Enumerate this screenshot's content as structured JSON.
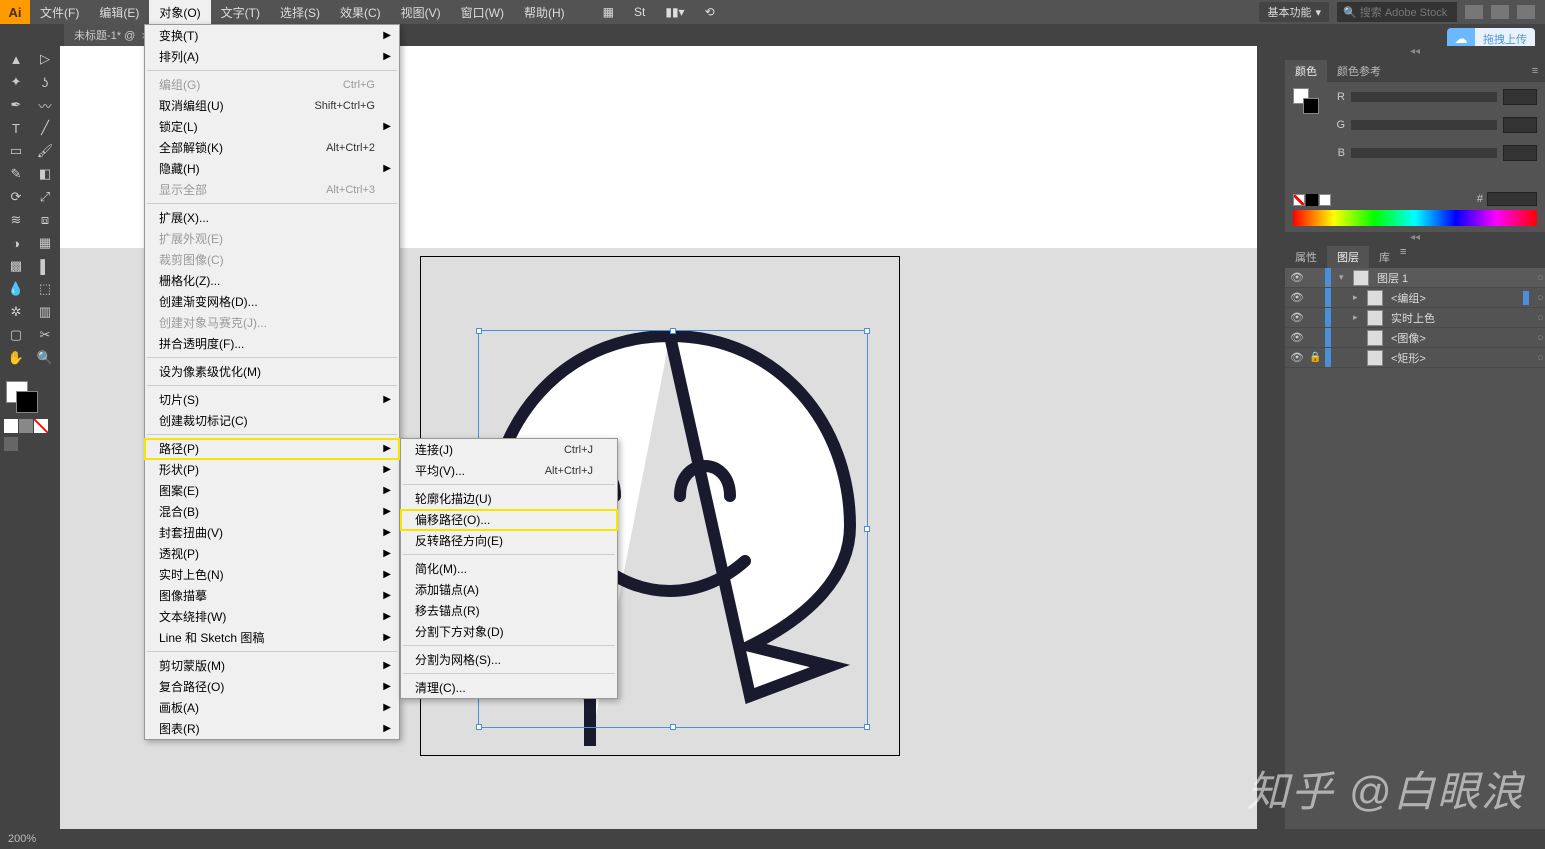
{
  "app": {
    "logo": "Ai"
  },
  "menubar": {
    "items": [
      "文件(F)",
      "编辑(E)",
      "对象(O)",
      "文字(T)",
      "选择(S)",
      "效果(C)",
      "视图(V)",
      "窗口(W)",
      "帮助(H)"
    ],
    "active_index": 2,
    "workspace": "基本功能",
    "stock_placeholder": "搜索 Adobe Stock"
  },
  "doctab": {
    "title": "未标题-1* @"
  },
  "upload_badge": "拖拽上传",
  "object_menu": [
    {
      "label": "变换(T)",
      "arrow": true
    },
    {
      "label": "排列(A)",
      "arrow": true
    },
    {
      "sep": true
    },
    {
      "label": "编组(G)",
      "shortcut": "Ctrl+G",
      "disabled": true
    },
    {
      "label": "取消编组(U)",
      "shortcut": "Shift+Ctrl+G"
    },
    {
      "label": "锁定(L)",
      "arrow": true
    },
    {
      "label": "全部解锁(K)",
      "shortcut": "Alt+Ctrl+2"
    },
    {
      "label": "隐藏(H)",
      "arrow": true
    },
    {
      "label": "显示全部",
      "shortcut": "Alt+Ctrl+3",
      "disabled": true
    },
    {
      "sep": true
    },
    {
      "label": "扩展(X)..."
    },
    {
      "label": "扩展外观(E)",
      "disabled": true
    },
    {
      "label": "裁剪图像(C)",
      "disabled": true
    },
    {
      "label": "栅格化(Z)..."
    },
    {
      "label": "创建渐变网格(D)..."
    },
    {
      "label": "创建对象马赛克(J)...",
      "disabled": true
    },
    {
      "label": "拼合透明度(F)..."
    },
    {
      "sep": true
    },
    {
      "label": "设为像素级优化(M)"
    },
    {
      "sep": true
    },
    {
      "label": "切片(S)",
      "arrow": true
    },
    {
      "label": "创建裁切标记(C)"
    },
    {
      "sep": true
    },
    {
      "label": "路径(P)",
      "arrow": true,
      "highlight": true
    },
    {
      "label": "形状(P)",
      "arrow": true
    },
    {
      "label": "图案(E)",
      "arrow": true
    },
    {
      "label": "混合(B)",
      "arrow": true
    },
    {
      "label": "封套扭曲(V)",
      "arrow": true
    },
    {
      "label": "透视(P)",
      "arrow": true
    },
    {
      "label": "实时上色(N)",
      "arrow": true
    },
    {
      "label": "图像描摹",
      "arrow": true
    },
    {
      "label": "文本绕排(W)",
      "arrow": true
    },
    {
      "label": "Line 和 Sketch 图稿",
      "arrow": true
    },
    {
      "sep": true
    },
    {
      "label": "剪切蒙版(M)",
      "arrow": true
    },
    {
      "label": "复合路径(O)",
      "arrow": true
    },
    {
      "label": "画板(A)",
      "arrow": true
    },
    {
      "label": "图表(R)",
      "arrow": true
    }
  ],
  "path_submenu": [
    {
      "label": "连接(J)",
      "shortcut": "Ctrl+J"
    },
    {
      "label": "平均(V)...",
      "shortcut": "Alt+Ctrl+J"
    },
    {
      "sep": true
    },
    {
      "label": "轮廓化描边(U)"
    },
    {
      "label": "偏移路径(O)...",
      "highlight": true
    },
    {
      "label": "反转路径方向(E)"
    },
    {
      "sep": true
    },
    {
      "label": "简化(M)..."
    },
    {
      "label": "添加锚点(A)"
    },
    {
      "label": "移去锚点(R)"
    },
    {
      "label": "分割下方对象(D)"
    },
    {
      "sep": true
    },
    {
      "label": "分割为网格(S)..."
    },
    {
      "sep": true
    },
    {
      "label": "清理(C)..."
    }
  ],
  "tools": [
    "selection",
    "direct-selection",
    "magic-wand",
    "lasso",
    "pen",
    "curvature",
    "type",
    "line",
    "rectangle",
    "brush",
    "shaper",
    "eraser",
    "rotate",
    "scale",
    "width",
    "free-transform",
    "shape-builder",
    "perspective",
    "mesh",
    "gradient",
    "eyedropper",
    "blend",
    "symbol-sprayer",
    "column-graph",
    "artboard",
    "slice",
    "hand",
    "zoom"
  ],
  "color_panel": {
    "tab_color": "颜色",
    "tab_guide": "颜色参考",
    "r": "R",
    "g": "G",
    "b": "B",
    "hash": "#"
  },
  "props_tabs": {
    "props": "属性",
    "layers": "图层",
    "lib": "库"
  },
  "layers": [
    {
      "name": "图层 1",
      "indent": 0,
      "chev": "▾",
      "top": true
    },
    {
      "name": "<编组>",
      "indent": 1,
      "chev": "▸",
      "sel": true
    },
    {
      "name": "实时上色",
      "indent": 1,
      "chev": "▸"
    },
    {
      "name": "<图像>",
      "indent": 1,
      "chev": ""
    },
    {
      "name": "<矩形>",
      "indent": 1,
      "chev": "",
      "lock": true
    }
  ],
  "status": {
    "zoom": "200%",
    "info": ""
  },
  "watermark": "知乎 @白眼浪"
}
